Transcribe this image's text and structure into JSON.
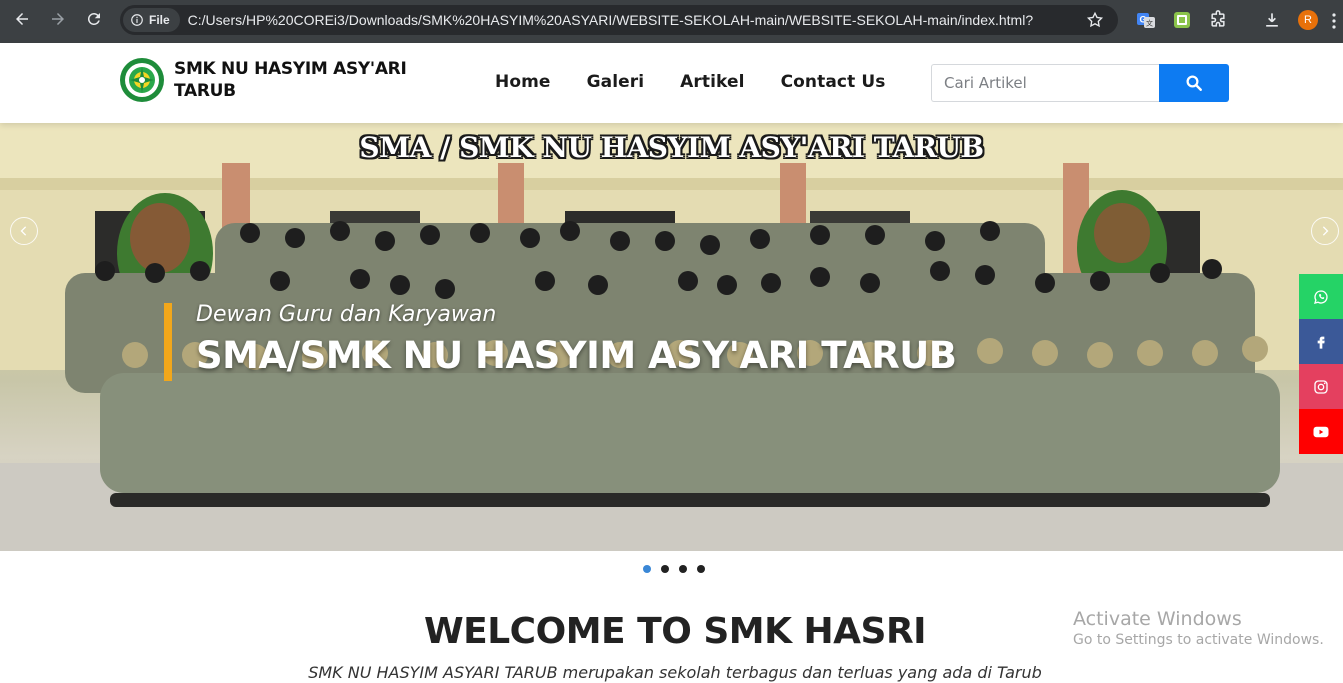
{
  "browser": {
    "site_chip_label": "File",
    "url": "C:/Users/HP%20COREi3/Downloads/SMK%20HASYIM%20ASYARI/WEBSITE-SEKOLAH-main/WEBSITE-SEKOLAH-main/index.html?",
    "profile_initial": "R",
    "icons": [
      "back-icon",
      "forward-icon",
      "reload-icon",
      "info-icon",
      "star-icon",
      "translate-extension-icon",
      "sheet-extension-icon",
      "puzzle-extensions-icon",
      "download-icon",
      "kebab-menu-icon"
    ]
  },
  "header": {
    "brand_line1": "SMK NU HASYIM ASY'ARI",
    "brand_line2": "TARUB",
    "nav": [
      "Home",
      "Galeri",
      "Artikel",
      "Contact Us"
    ],
    "search_placeholder": "Cari Artikel"
  },
  "hero": {
    "banner_text": "SMA / SMK NU HASYIM ASY'ARI TARUB",
    "caption_sub": "Dewan Guru dan Karyawan",
    "caption_title": "SMA/SMK NU HASYIM ASY'ARI TARUB",
    "slide_count": 4,
    "active_slide": 1
  },
  "social": [
    {
      "name": "whatsapp-icon",
      "color": "#25d366"
    },
    {
      "name": "facebook-icon",
      "color": "#3b5998"
    },
    {
      "name": "instagram-icon",
      "color": "#e4405f"
    },
    {
      "name": "youtube-icon",
      "color": "#ff0000"
    }
  ],
  "welcome": {
    "title": "WELCOME TO SMK HASRI",
    "subtitle": "SMK NU HASYIM ASYARI TARUB merupakan sekolah terbagus dan terluas yang ada di Tarub"
  },
  "watermark": {
    "line1": "Activate Windows",
    "line2": "Go to Settings to activate Windows."
  },
  "colors": {
    "accent": "#0d7bf2",
    "caption_bar": "#f2a71b",
    "chrome_bg": "#3c4043"
  }
}
